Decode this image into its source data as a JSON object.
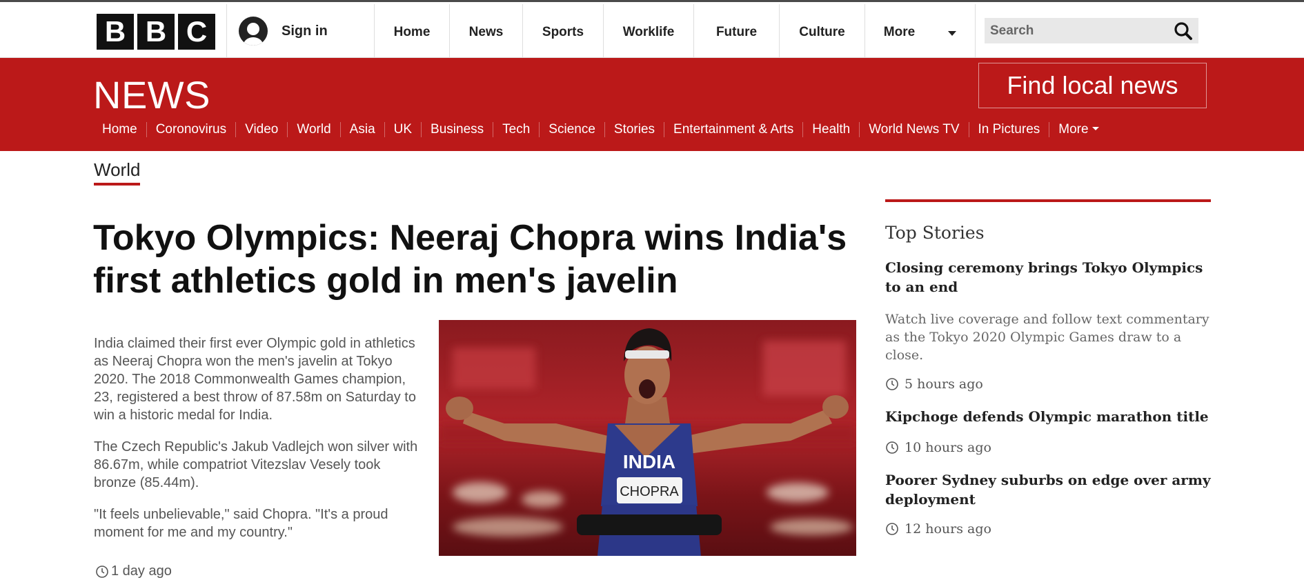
{
  "topbar": {
    "logo_letters": [
      "B",
      "B",
      "C"
    ],
    "sign_in": "Sign in",
    "nav": [
      {
        "label": "Home"
      },
      {
        "label": "News"
      },
      {
        "label": "Sports"
      },
      {
        "label": "Worklife"
      },
      {
        "label": "Future"
      },
      {
        "label": "Culture"
      },
      {
        "label": "More"
      }
    ],
    "search_placeholder": "Search",
    "icons": {
      "search": "search-icon",
      "user": "user-avatar-icon",
      "more": "chevron-down-icon"
    }
  },
  "banner": {
    "title": "NEWS",
    "find_local": "Find local news",
    "color": "#bb1919",
    "nav": [
      {
        "label": "Home"
      },
      {
        "label": "Coronovirus"
      },
      {
        "label": "Video"
      },
      {
        "label": "World"
      },
      {
        "label": "Asia"
      },
      {
        "label": "UK"
      },
      {
        "label": "Business"
      },
      {
        "label": "Tech"
      },
      {
        "label": "Science"
      },
      {
        "label": "Stories"
      },
      {
        "label": "Entertainment & Arts"
      },
      {
        "label": "Health"
      },
      {
        "label": "World News TV"
      },
      {
        "label": "In Pictures"
      },
      {
        "label": "More"
      }
    ]
  },
  "section": "World",
  "article": {
    "headline": "Tokyo Olympics: Neeraj Chopra wins India's first athletics gold in men's javelin",
    "paragraphs": [
      "India claimed their first ever Olympic gold in athletics as Neeraj Chopra won the men's javelin at Tokyo 2020. The 2018 Commonwealth Games champion, 23, registered a best throw of 87.58m on Saturday to win a historic medal for India.",
      "The Czech Republic's Jakub Vadlejch won silver with 86.67m, while compatriot Vitezslav Vesely took bronze (85.44m).",
      "\"It feels unbelievable,\" said Chopra. \"It's a proud moment for me and my country.\""
    ],
    "timestamp": "1 day ago",
    "photo": {
      "vest_text": "INDIA",
      "bib_text": "CHOPRA"
    }
  },
  "sidebar": {
    "title": "Top Stories",
    "stories": [
      {
        "headline": "Closing ceremony brings Tokyo Olympics to an end",
        "summary": "Watch live coverage and follow text commentary as the Tokyo 2020 Olympic Games draw to a close.",
        "time": "5 hours ago"
      },
      {
        "headline": "Kipchoge defends Olympic marathon title",
        "summary": "",
        "time": "10 hours ago"
      },
      {
        "headline": "Poorer Sydney suburbs on edge over army deployment",
        "summary": "",
        "time": "12 hours ago"
      }
    ]
  }
}
